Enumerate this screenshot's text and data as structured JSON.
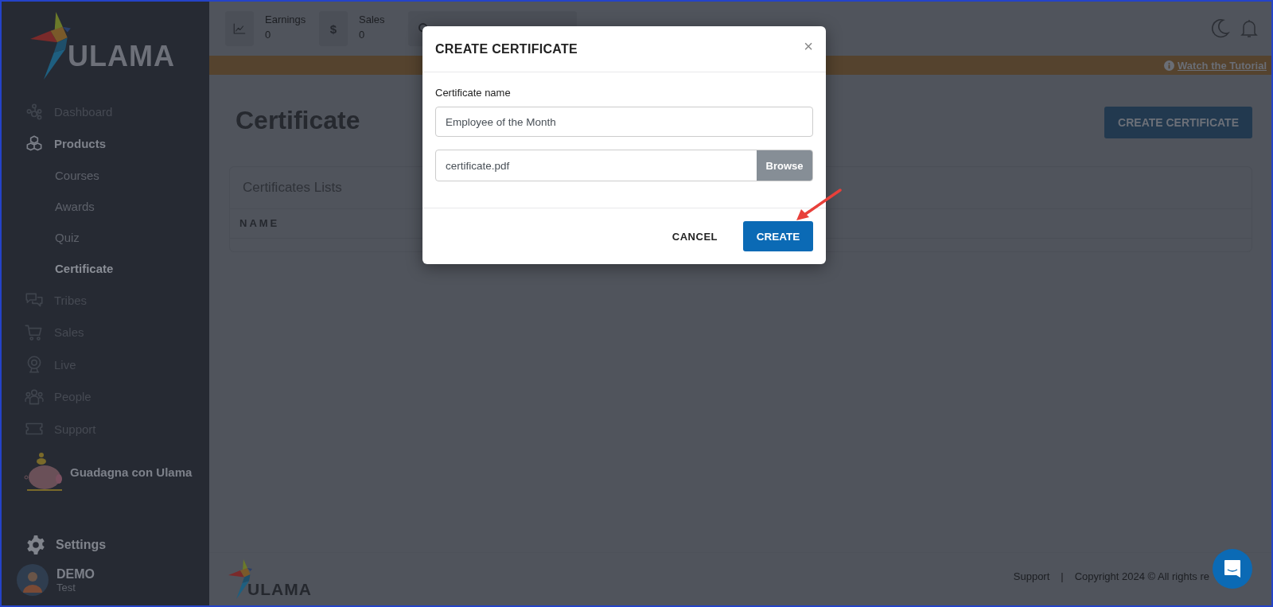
{
  "sidebar": {
    "logo": "ULAMA",
    "items": [
      {
        "kind": "link",
        "label": "Dashboard"
      },
      {
        "kind": "group",
        "label": "Products",
        "expanded": true,
        "children": [
          {
            "label": "Courses",
            "selected": false
          },
          {
            "label": "Awards",
            "selected": false
          },
          {
            "label": "Quiz",
            "selected": false
          },
          {
            "label": "Certificate",
            "selected": true
          }
        ]
      },
      {
        "kind": "link",
        "label": "Tribes"
      },
      {
        "kind": "link",
        "label": "Sales"
      },
      {
        "kind": "link",
        "label": "Live"
      },
      {
        "kind": "link",
        "label": "People"
      },
      {
        "kind": "link",
        "label": "Support"
      }
    ],
    "promo": "Guadagna con Ulama",
    "settings": "Settings",
    "user": {
      "name": "DEMO",
      "role": "Test"
    }
  },
  "topbar": {
    "stats": [
      {
        "label": "Earnings",
        "value": "0"
      },
      {
        "symbol": "$",
        "label": "Sales",
        "value": "0"
      }
    ],
    "tutorial": "Watch the Tutorial"
  },
  "page": {
    "title": "Certificate",
    "action": "CREATE CERTIFICATE",
    "card_title": "Certificates Lists",
    "columns": [
      "NAME"
    ]
  },
  "footer": {
    "logo": "ULAMA",
    "link": "Support",
    "separator": "|",
    "copyright": "Copyright 2024 © All rights re"
  },
  "modal": {
    "title": "CREATE CERTIFICATE",
    "close": "×",
    "name_label": "Certificate name",
    "name_value": "Employee of the Month",
    "file_value": "certificate.pdf",
    "browse": "Browse",
    "cancel": "CANCEL",
    "create": "CREATE"
  }
}
